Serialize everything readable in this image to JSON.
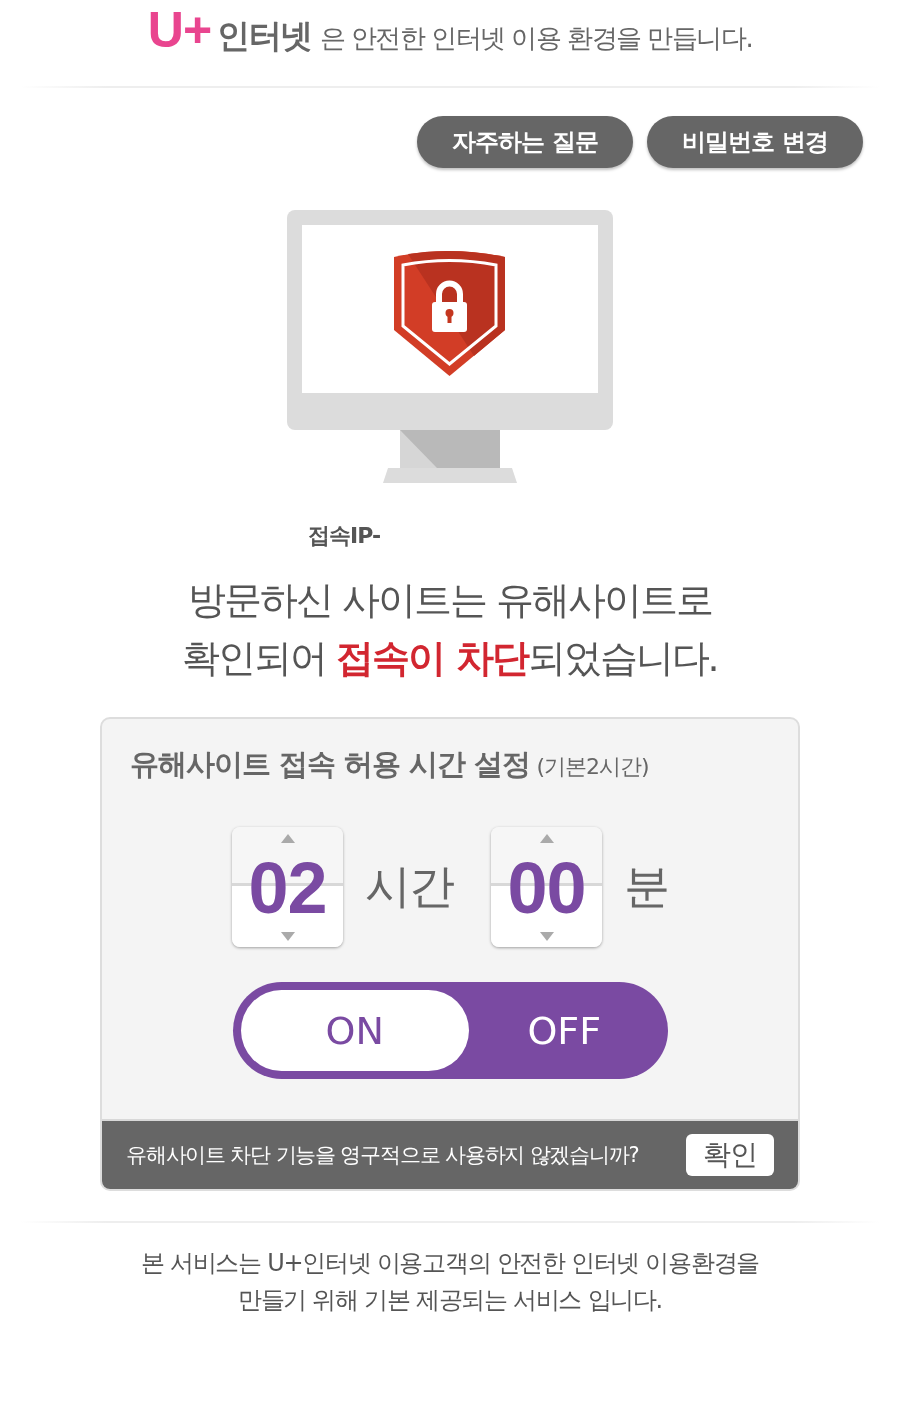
{
  "header": {
    "brand_mark": "U+",
    "brand_name": "인터넷",
    "tagline": "은 안전한 인터넷 이용 환경을 만듭니다."
  },
  "top_buttons": [
    {
      "label": "자주하는 질문"
    },
    {
      "label": "비밀번호 변경"
    }
  ],
  "connection_ip": "접속IP-",
  "message": {
    "lines": [
      "방문하신 사이트는 유해사이트로",
      "확인되어 **접속이 차단**되었습니다."
    ]
  },
  "panel": {
    "title": "유해사이트 접속 허용 시간 설정",
    "title_note": "(기본2시간)",
    "spinners": [
      {
        "value": "02",
        "unit": "시간"
      },
      {
        "value": "00",
        "unit": "분"
      }
    ],
    "toggle": [
      {
        "label": "ON",
        "selected": true
      },
      {
        "label": "OFF",
        "selected": false
      }
    ],
    "footer": {
      "question": "유해사이트 차단 기능을 영구적으로 사용하지 않겠습니까?",
      "button": "확인"
    }
  },
  "notice": {
    "lines": [
      "본 서비스는 U+인터넷 이용고객의 안전한 인터넷 이용환경을",
      "만들기 위해 기본 제공되는 서비스 입니다."
    ]
  }
}
